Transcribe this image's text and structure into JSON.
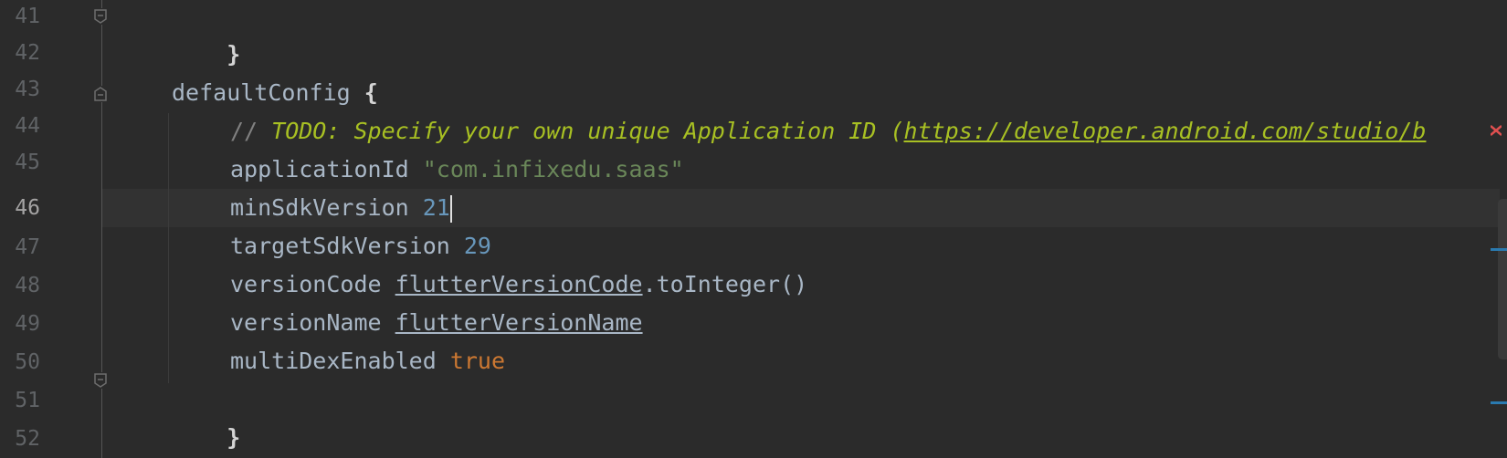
{
  "editor": {
    "line_numbers": [
      "41",
      "42",
      "43",
      "44",
      "45",
      "46",
      "47",
      "48",
      "49",
      "50",
      "51",
      "52"
    ],
    "current_line": "46",
    "code": {
      "l41_brace": "}",
      "l43_name": "defaultConfig ",
      "l43_brace": "{",
      "l44_comment_prefix": "// ",
      "l44_todo": "TODO: Specify your own unique Application ID (",
      "l44_link": "https://developer.android.com/studio/b",
      "l45_key": "applicationId ",
      "l45_value": "\"com.infixedu.saas\"",
      "l46_key": "minSdkVersion ",
      "l46_value": "21",
      "l47_key": "targetSdkVersion ",
      "l47_value": "29",
      "l48_key": "versionCode ",
      "l48_ref": "flutterVersionCode",
      "l48_call": ".toInteger()",
      "l49_key": "versionName ",
      "l49_ref": "flutterVersionName",
      "l50_key": "multiDexEnabled ",
      "l50_value": "true",
      "l51_brace": "}"
    },
    "colors": {
      "background": "#2b2b2b",
      "current_line": "#323232",
      "string": "#6a8759",
      "number": "#6897bb",
      "keyword": "#cc7832",
      "todo": "#a8c023",
      "comment": "#808080",
      "marker": "#2a7ab0"
    },
    "icons": {
      "fold_start": "fold-start-icon",
      "fold_end": "fold-end-icon",
      "error_marker": "error-marker-icon"
    }
  }
}
